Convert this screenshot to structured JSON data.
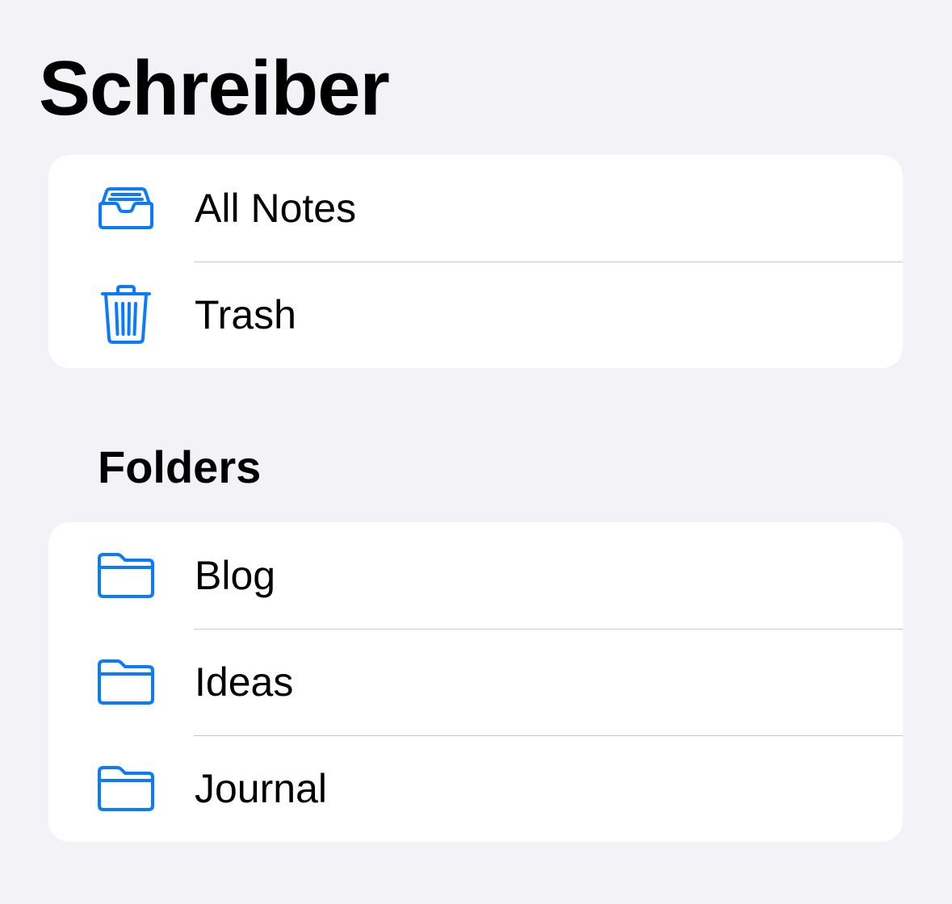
{
  "app": {
    "title": "Schreiber"
  },
  "library": {
    "items": [
      {
        "label": "All Notes",
        "icon": "tray-icon"
      },
      {
        "label": "Trash",
        "icon": "trash-icon"
      }
    ]
  },
  "folders": {
    "header": "Folders",
    "items": [
      {
        "label": "Blog",
        "icon": "folder-icon"
      },
      {
        "label": "Ideas",
        "icon": "folder-icon"
      },
      {
        "label": "Journal",
        "icon": "folder-icon"
      }
    ]
  },
  "colors": {
    "accent": "#0a7aff",
    "background": "#f2f2f7",
    "card": "#ffffff",
    "separator": "#c6c6c8"
  }
}
